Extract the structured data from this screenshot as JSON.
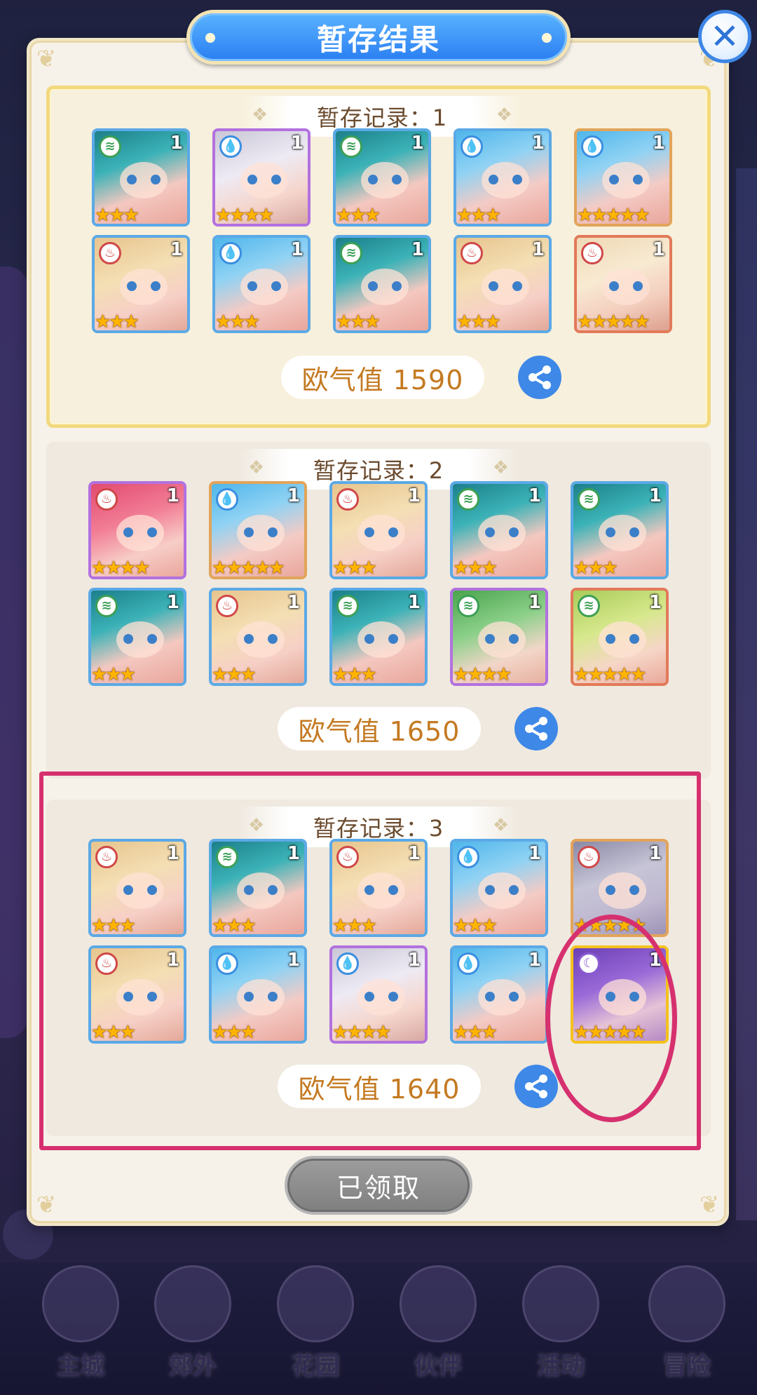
{
  "background": {
    "nav": [
      "主城",
      "郊外",
      "花园",
      "伙伴",
      "活动",
      "冒险"
    ]
  },
  "dialog": {
    "title": "暂存结果",
    "close_glyph": "✕",
    "claimed_label": "已领取"
  },
  "records": [
    {
      "header": "暂存记录：1",
      "score": "欧气值 1590",
      "cards": [
        {
          "art": "teal",
          "frame": "blue",
          "element": "wind",
          "count": "1",
          "stars": 3
        },
        {
          "art": "silver",
          "frame": "purple",
          "element": "water",
          "count": "1",
          "stars": 4
        },
        {
          "art": "teal",
          "frame": "blue",
          "element": "wind",
          "count": "1",
          "stars": 3
        },
        {
          "art": "skyblue",
          "frame": "blue",
          "element": "water",
          "count": "1",
          "stars": 3
        },
        {
          "art": "skyblue",
          "frame": "orange",
          "element": "water",
          "count": "1",
          "stars": 5
        },
        {
          "art": "blonde",
          "frame": "blue",
          "element": "fire",
          "count": "1",
          "stars": 3
        },
        {
          "art": "skyblue",
          "frame": "blue",
          "element": "water",
          "count": "1",
          "stars": 3
        },
        {
          "art": "teal",
          "frame": "blue",
          "element": "wind",
          "count": "1",
          "stars": 3
        },
        {
          "art": "blonde",
          "frame": "blue",
          "element": "fire",
          "count": "1",
          "stars": 3
        },
        {
          "art": "cream",
          "frame": "red",
          "element": "fire",
          "count": "1",
          "stars": 5
        }
      ]
    },
    {
      "header": "暂存记录：2",
      "score": "欧气值 1650",
      "cards": [
        {
          "art": "pink",
          "frame": "purple",
          "element": "fire",
          "count": "1",
          "stars": 4
        },
        {
          "art": "skyblue",
          "frame": "orange",
          "element": "water",
          "count": "1",
          "stars": 5
        },
        {
          "art": "blonde",
          "frame": "blue",
          "element": "fire",
          "count": "1",
          "stars": 3
        },
        {
          "art": "teal",
          "frame": "blue",
          "element": "wind",
          "count": "1",
          "stars": 3
        },
        {
          "art": "teal",
          "frame": "blue",
          "element": "wind",
          "count": "1",
          "stars": 3
        },
        {
          "art": "teal",
          "frame": "blue",
          "element": "wind",
          "count": "1",
          "stars": 3
        },
        {
          "art": "blonde",
          "frame": "blue",
          "element": "fire",
          "count": "1",
          "stars": 3
        },
        {
          "art": "teal",
          "frame": "blue",
          "element": "wind",
          "count": "1",
          "stars": 3
        },
        {
          "art": "green",
          "frame": "purple",
          "element": "wind",
          "count": "1",
          "stars": 4
        },
        {
          "art": "lime",
          "frame": "red",
          "element": "wind",
          "count": "1",
          "stars": 5
        }
      ]
    },
    {
      "header": "暂存记录：3",
      "score": "欧气值 1640",
      "cards": [
        {
          "art": "blonde",
          "frame": "blue",
          "element": "fire",
          "count": "1",
          "stars": 3
        },
        {
          "art": "teal",
          "frame": "blue",
          "element": "wind",
          "count": "1",
          "stars": 3
        },
        {
          "art": "blonde",
          "frame": "blue",
          "element": "fire",
          "count": "1",
          "stars": 3
        },
        {
          "art": "skyblue",
          "frame": "blue",
          "element": "water",
          "count": "1",
          "stars": 3
        },
        {
          "art": "grey",
          "frame": "orange",
          "element": "fire",
          "count": "1",
          "stars": 5
        },
        {
          "art": "blonde",
          "frame": "blue",
          "element": "fire",
          "count": "1",
          "stars": 3
        },
        {
          "art": "skyblue",
          "frame": "blue",
          "element": "water",
          "count": "1",
          "stars": 3
        },
        {
          "art": "silver",
          "frame": "purple",
          "element": "water",
          "count": "1",
          "stars": 4
        },
        {
          "art": "skyblue",
          "frame": "blue",
          "element": "water",
          "count": "1",
          "stars": 3
        },
        {
          "art": "violet",
          "frame": "gold",
          "element": "moon",
          "count": "1",
          "stars": 5
        }
      ]
    }
  ],
  "colors": {
    "title_banner": "#2a7ef2",
    "highlight": "#d6306f",
    "score_text": "#c47a22",
    "star": "#ffb400"
  }
}
